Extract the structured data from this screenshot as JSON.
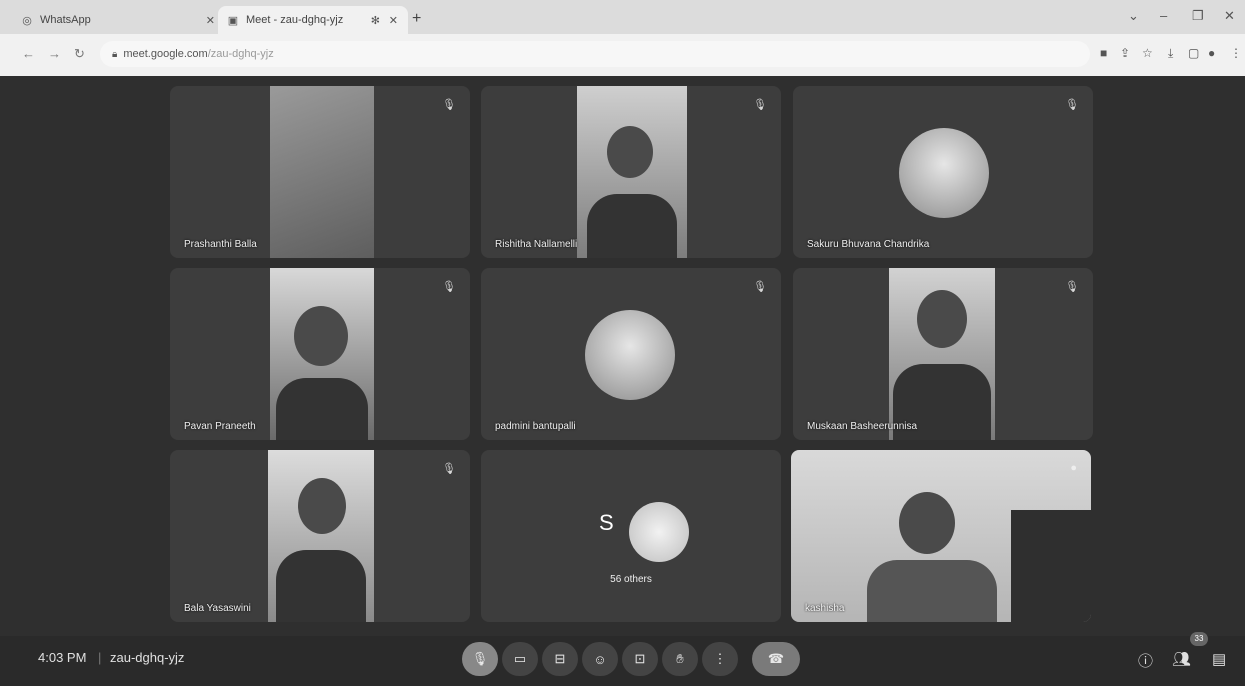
{
  "browser": {
    "tabs": [
      {
        "label": "WhatsApp",
        "icon": "whatsapp-icon"
      },
      {
        "label": "Meet - zau-dghq-yjz",
        "icon": "meet-icon"
      }
    ],
    "url_host": "meet.google.com",
    "url_path": "/zau-dghq-yjz"
  },
  "tiles": [
    {
      "name": "Prashanthi Balla",
      "kind": "video"
    },
    {
      "name": "Rishitha Nallamelli",
      "kind": "video"
    },
    {
      "name": "Sakuru Bhuvana Chandrika",
      "kind": "avatar"
    },
    {
      "name": "Pavan Praneeth",
      "kind": "video"
    },
    {
      "name": "padmini bantupalli",
      "kind": "avatar"
    },
    {
      "name": "Muskaan Basheerunnisa",
      "kind": "video"
    },
    {
      "name": "Bala Yasaswini",
      "kind": "video"
    },
    {
      "name": "56 others",
      "kind": "others",
      "initial": "S"
    },
    {
      "name": "kashisha",
      "kind": "video"
    }
  ],
  "meeting": {
    "time": "4:03 PM",
    "code": "zau-dghq-yjz",
    "participants_count": "33"
  },
  "controls": [
    "mic-off-icon",
    "camera-icon",
    "captions-icon",
    "emoji-icon",
    "present-icon",
    "raise-hand-icon",
    "more-options-icon",
    "end-call-icon"
  ]
}
